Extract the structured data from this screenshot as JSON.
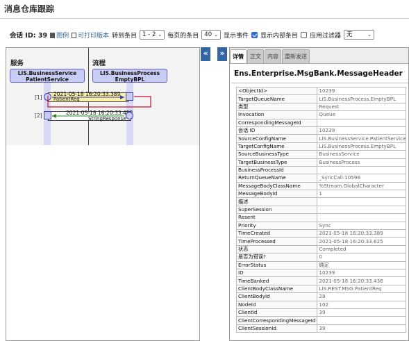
{
  "page": {
    "title": "消息仓库跟踪"
  },
  "toolbar": {
    "session_label": "会话 ID: 39",
    "legend_label": "图例",
    "printable_label": "可打印版本",
    "goto_label": "转到条目",
    "goto_value": "1 - 2",
    "per_page_label": "每页的条目",
    "per_page_value": "40",
    "show_events_label": "显示事件",
    "show_internal_label": "显示内部条目",
    "apply_filter_label": "应用过滤器",
    "filter_value": "无"
  },
  "diagram": {
    "columns": [
      {
        "header": "服务",
        "actor_line1": "LIS.BusinessService",
        "actor_line2": "PatientService"
      },
      {
        "header": "流程",
        "actor_line1": "LIS.BusinessProcess",
        "actor_line2": "EmptyBPL"
      }
    ],
    "messages": [
      {
        "num": "[1]",
        "timestamp": "2021-05-18 16:20:33.389",
        "name": "PatientReq",
        "direction": "right"
      },
      {
        "num": "[2]",
        "timestamp": "2021-05-18 16:20:33.452",
        "name": "StringResponse",
        "direction": "left"
      }
    ],
    "colors": {
      "actor_fill": "#c9ccf5",
      "request_fill": "#fbf0a8",
      "link_red": "#c8102e",
      "arrow_blue": "#3a3fb0",
      "arrow_green": "#2a8a2a"
    }
  },
  "splitter": {
    "collapse_left": "«",
    "collapse_right": "»"
  },
  "tabs": [
    "详情",
    "正文",
    "内容",
    "重新发送"
  ],
  "detail": {
    "title": "Ens.Enterprise.MsgBank.MessageHeader",
    "rows": [
      {
        "key": "<ObjectId>",
        "value": "10239"
      },
      {
        "key": "TargetQueueName",
        "value": "LIS.BusinessProcess.EmptyBPL"
      },
      {
        "key": "类型",
        "value": "Request"
      },
      {
        "key": "Invocation",
        "value": "Queue"
      },
      {
        "key": "CorrespondingMessageId",
        "value": ""
      },
      {
        "key": "会话 ID",
        "value": "10239"
      },
      {
        "key": "SourceConfigName",
        "value": "LIS.BusinessService.PatientService"
      },
      {
        "key": "TargetConfigName",
        "value": "LIS.BusinessProcess.EmptyBPL"
      },
      {
        "key": "SourceBusinessType",
        "value": "BusinessService"
      },
      {
        "key": "TargetBusinessType",
        "value": "BusinessProcess"
      },
      {
        "key": "BusinessProcessId",
        "value": ""
      },
      {
        "key": "ReturnQueueName",
        "value": "_SyncCall:10596"
      },
      {
        "key": "MessageBodyClassName",
        "value": "%Stream.GlobalCharacter"
      },
      {
        "key": "MessageBodyId",
        "value": "1"
      },
      {
        "key": "描述",
        "value": ""
      },
      {
        "key": "SuperSession",
        "value": ""
      },
      {
        "key": "Resent",
        "value": ""
      },
      {
        "key": "Priority",
        "value": "Sync"
      },
      {
        "key": "TimeCreated",
        "value": "2021-05-18 16:20:33.389"
      },
      {
        "key": "TimeProcessed",
        "value": "2021-05-18 16:20:33.625"
      },
      {
        "key": "状态",
        "value": "Completed"
      },
      {
        "key": "是否为错误?",
        "value": "0"
      },
      {
        "key": "ErrorStatus",
        "value": "确定"
      },
      {
        "key": "ID",
        "value": "10239"
      },
      {
        "key": "TimeBanked",
        "value": "2021-05-18 16:20:33.436"
      },
      {
        "key": "ClientBodyClassName",
        "value": "LIS.REST.MSG.PatientReq"
      },
      {
        "key": "ClientBodyId",
        "value": "29"
      },
      {
        "key": "NodeId",
        "value": "102"
      },
      {
        "key": "ClientId",
        "value": "39"
      },
      {
        "key": "ClientCorrespondingMessageId",
        "value": ""
      },
      {
        "key": "ClientSessionId",
        "value": "39"
      }
    ]
  }
}
